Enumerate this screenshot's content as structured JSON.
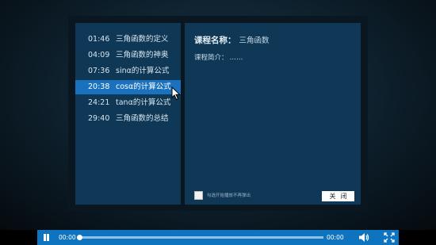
{
  "playlist": {
    "items": [
      {
        "time": "01:46",
        "title": "三角函数的定义"
      },
      {
        "time": "04:09",
        "title": "三角函数的神奥"
      },
      {
        "time": "07:36",
        "title": "sinα的计算公式"
      },
      {
        "time": "20:38",
        "title": "cosα的计算公式"
      },
      {
        "time": "24:21",
        "title": "tanα的计算公式"
      },
      {
        "time": "29:40",
        "title": "三角函数的总结"
      }
    ],
    "active_index": 3
  },
  "info": {
    "course_label": "课程名称：",
    "course_value": "三角函数",
    "intro_label": "课程简介：",
    "intro_value": "……",
    "checkbox_label": "勾选开始播放不再弹出",
    "close_label": "关闭"
  },
  "player": {
    "current_time": "00:00",
    "duration": "00:00",
    "progress": 0,
    "play_icon": "pause-icon",
    "volume_icon": "volume-icon",
    "fullscreen_icon": "fullscreen-icon"
  },
  "colors": {
    "accent": "#1a72be",
    "panel": "#0f3856",
    "controlbar": "#0e74c0"
  }
}
